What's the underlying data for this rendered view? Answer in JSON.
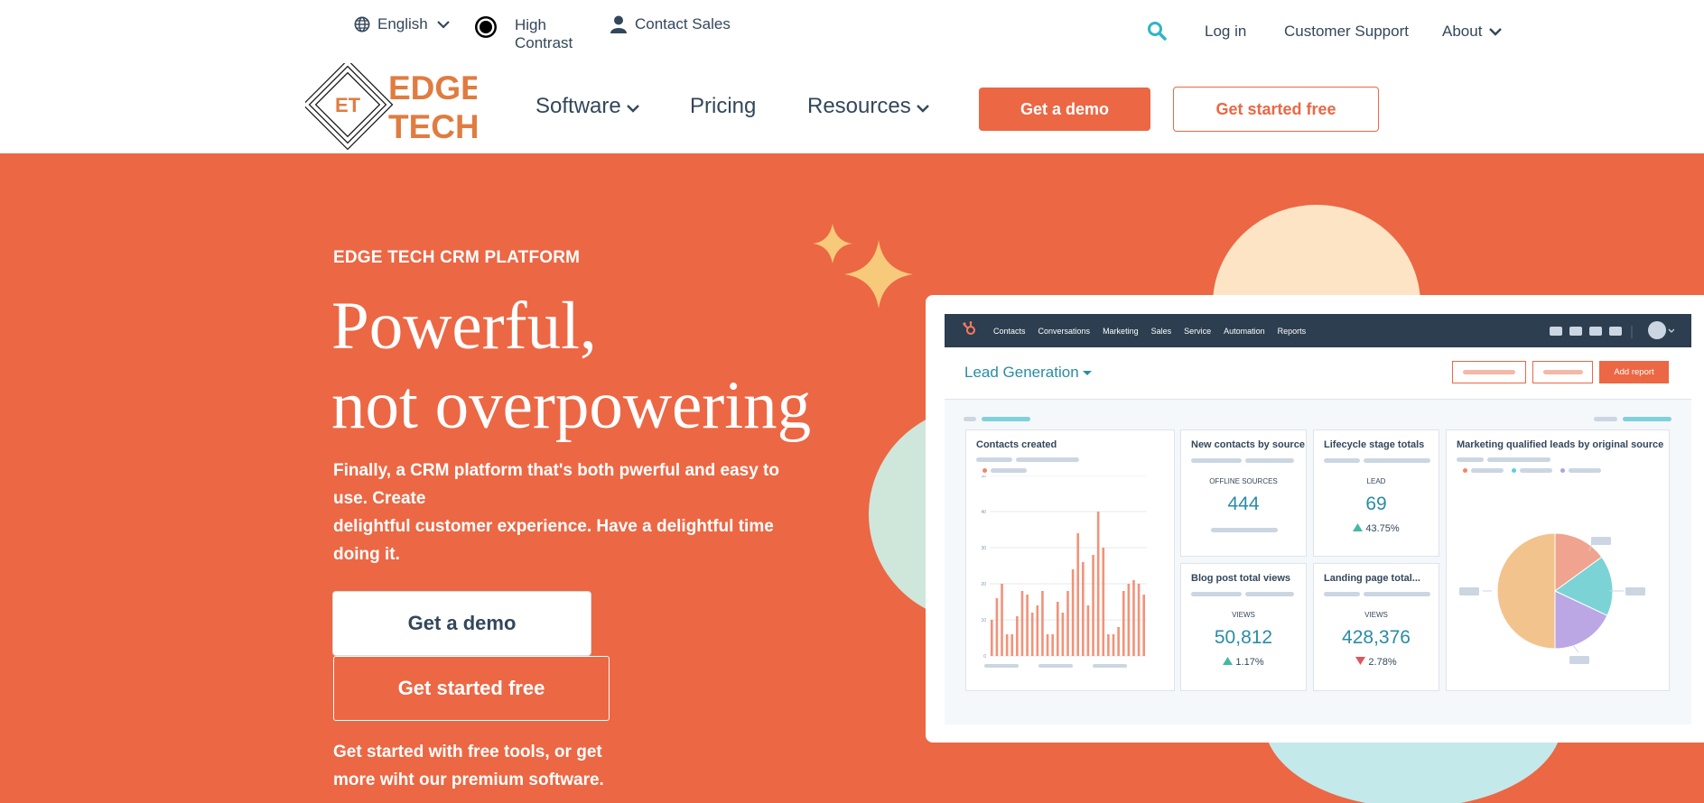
{
  "utility": {
    "language": "English",
    "contrast": "High Contrast",
    "contact": "Contact Sales",
    "login": "Log in",
    "support": "Customer Support",
    "about": "About"
  },
  "logo": {
    "mark": "ET",
    "line1": "EDGE",
    "line2": "TECH"
  },
  "nav": {
    "software": "Software",
    "pricing": "Pricing",
    "resources": "Resources",
    "demo": "Get a demo",
    "free": "Get started free"
  },
  "hero": {
    "eyebrow": "EDGE TECH CRM PLATFORM",
    "headline1": "Powerful,",
    "headline2": "not overpowering",
    "sub_line1": "Finally, a CRM platform that's both pwerful and easy to use. Create",
    "sub_line2": "delightful customer experience. Have a delightful time doing it.",
    "demo_button": "Get a demo",
    "free_button": "Get started free",
    "footnote": "Get started with free tools, or get more wiht our premium software."
  },
  "dashboard": {
    "menu": [
      "Contacts",
      "Conversations",
      "Marketing",
      "Sales",
      "Service",
      "Automation",
      "Reports"
    ],
    "title": "Lead Generation",
    "add_report": "Add report",
    "cards": {
      "contacts_created": "Contacts created",
      "new_contacts": "New contacts by source",
      "new_contacts_label": "OFFLINE SOURCES",
      "new_contacts_value": "444",
      "lifecycle": "Lifecycle stage totals",
      "lifecycle_label": "LEAD",
      "lifecycle_value": "69",
      "lifecycle_pct": "43.75%",
      "mql": "Marketing qualified leads by original source",
      "blog": "Blog post total views",
      "blog_label": "VIEWS",
      "blog_value": "50,812",
      "blog_pct": "1.17%",
      "landing": "Landing page total...",
      "landing_label": "VIEWS",
      "landing_value": "428,376",
      "landing_pct": "2.78%"
    },
    "y_ticks": [
      "50",
      "40",
      "30",
      "20",
      "10",
      "0"
    ]
  },
  "chart_data": {
    "type": "bar",
    "title": "Contacts created",
    "ylim": [
      0,
      50
    ],
    "values": [
      10,
      16,
      20,
      6,
      6,
      11,
      18,
      17,
      12,
      14,
      18,
      6,
      6,
      15,
      12,
      18,
      24,
      34,
      26,
      14,
      28,
      40,
      30,
      6,
      6,
      8,
      18,
      20,
      21,
      20,
      17
    ]
  },
  "pie_data": {
    "type": "pie",
    "values": [
      50,
      15,
      17,
      18
    ],
    "colors": [
      "#f2c38d",
      "#f0a38e",
      "#7bd3d6",
      "#bba7e4"
    ]
  },
  "colors": {
    "accent": "#ec6744",
    "navy": "#33475b",
    "teal": "#2a8ca5"
  }
}
